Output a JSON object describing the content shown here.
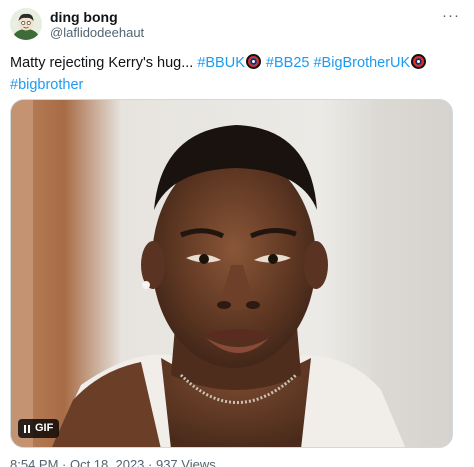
{
  "author": {
    "display_name": "ding bong",
    "handle": "@laflidodeehaut"
  },
  "more_menu": "···",
  "tweet": {
    "text_prefix": "Matty rejecting Kerry's hug... ",
    "hashtags": [
      "#BBUK",
      "#BB25",
      "#BigBrotherUK",
      "#bigbrother"
    ]
  },
  "media": {
    "type_label": "GIF",
    "playback_icon": "pause-icon"
  },
  "footer": {
    "timestamp": "8:54 PM · Oct 18, 2023 · 937 Views"
  },
  "colors": {
    "link": "#1d9bf0",
    "secondary_text": "#536471",
    "primary_text": "#0f1419"
  }
}
